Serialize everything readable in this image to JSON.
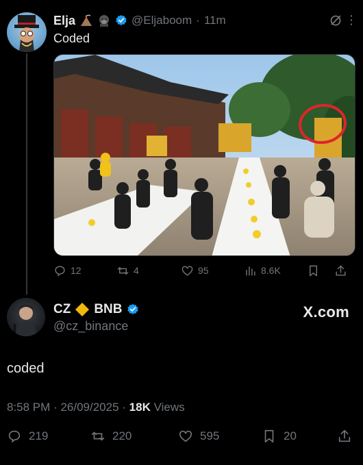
{
  "tweet1": {
    "name": "Elja",
    "emojis": [
      "volcano-emoji",
      "gorilla-emoji"
    ],
    "handle": "@Eljaboom",
    "time": "11m",
    "text": "Coded",
    "image_alt_icon": "event-photo",
    "stats": {
      "replies": "12",
      "retweets": "4",
      "likes": "95",
      "views": "8.6K"
    }
  },
  "tweet2": {
    "name": "CZ",
    "name_suffix": "BNB",
    "handle": "@cz_binance",
    "badge": "X.com",
    "text": "coded",
    "time": "8:58 PM",
    "date": "26/09/2025",
    "views_count": "18K",
    "views_label": "Views",
    "stats": {
      "replies": "219",
      "retweets": "220",
      "likes": "595",
      "bookmarks": "20"
    }
  },
  "colors": {
    "background": "#000000",
    "text": "#e7e9ea",
    "muted": "#71767b",
    "verified": "#1d9bf0",
    "bnb": "#f0b90b",
    "circle": "#e0242b"
  }
}
